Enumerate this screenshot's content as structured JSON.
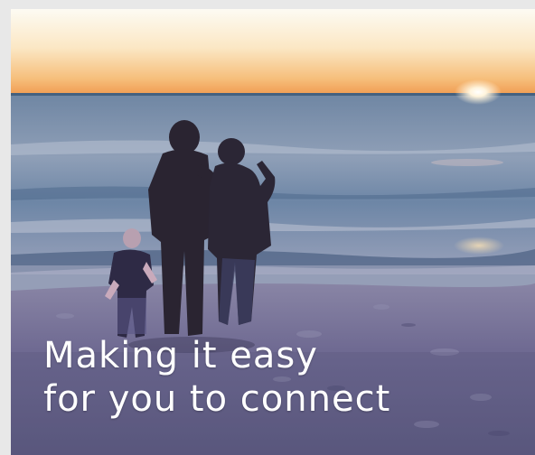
{
  "hero": {
    "headline_line1": "Making it easy",
    "headline_line2": "for you to connect",
    "image": "family-on-beach-at-sunset"
  },
  "colors": {
    "sky_top": "#fdfaf1",
    "sky_horizon": "#f3a75e",
    "sea": "#5f7a9a",
    "sand": "#77739a",
    "headline": "#ffffff"
  }
}
